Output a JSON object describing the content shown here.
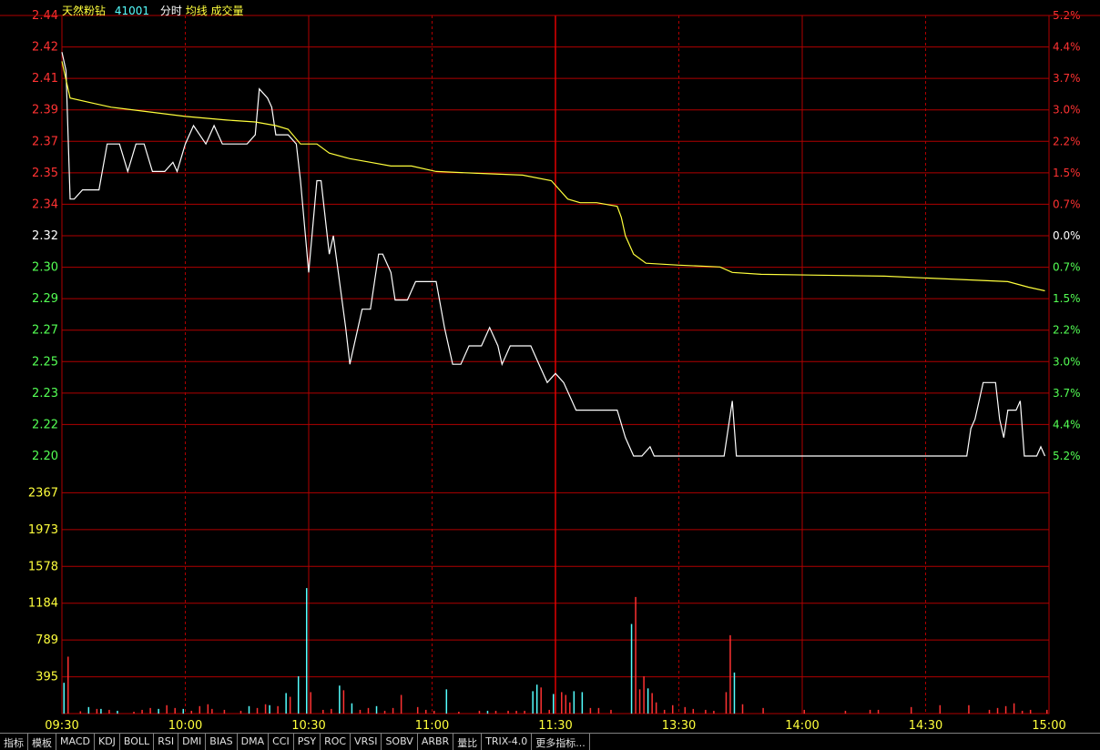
{
  "header": {
    "name": "天然粉钻",
    "code": "41001",
    "mode": "分时",
    "avg_label": "均线",
    "vol_label": "成交量"
  },
  "tabs": [
    "指标",
    "模板",
    "MACD",
    "KDJ",
    "BOLL",
    "RSI",
    "DMI",
    "BIAS",
    "DMA",
    "CCI",
    "PSY",
    "ROC",
    "VRSI",
    "SOBV",
    "ARBR",
    "量比",
    "TRIX-4.0",
    "更多指标..."
  ],
  "colors": {
    "grid": "#b00000",
    "up": "#ff3232",
    "down": "#54ff54",
    "flat": "#ffffff",
    "price_line": "#ffffff",
    "avg_line": "#ffff3c",
    "vol_up": "#ff3232",
    "vol_down": "#54ffff",
    "axis_text": "#ffff3c"
  },
  "chart_data": {
    "type": "line",
    "x_ticks": [
      "09:30",
      "10:00",
      "10:30",
      "11:00",
      "11:30",
      "13:30",
      "14:00",
      "14:30",
      "15:00"
    ],
    "price_ticks": [
      "2.44",
      "2.42",
      "2.41",
      "2.39",
      "2.37",
      "2.35",
      "2.34",
      "2.32",
      "2.30",
      "2.29",
      "2.27",
      "2.25",
      "2.23",
      "2.22",
      "2.20"
    ],
    "pct_ticks": [
      "5.2%",
      "4.4%",
      "3.7%",
      "3.0%",
      "2.2%",
      "1.5%",
      "0.7%",
      "0.0%",
      "0.7%",
      "1.5%",
      "2.2%",
      "3.0%",
      "3.7%",
      "4.4%",
      "5.2%"
    ],
    "volume_ticks": [
      "2367",
      "1973",
      "1578",
      "1184",
      "789",
      "395"
    ],
    "ylim": [
      2.2,
      2.44
    ],
    "prev_close": 2.32,
    "volume_ylim": [
      0,
      2760
    ],
    "minutes_total": 240,
    "series": [
      {
        "key": "price",
        "points": [
          [
            0,
            2.42
          ],
          [
            1,
            2.41
          ],
          [
            2,
            2.34
          ],
          [
            3,
            2.34
          ],
          [
            5,
            2.345
          ],
          [
            9,
            2.345
          ],
          [
            11,
            2.37
          ],
          [
            14,
            2.37
          ],
          [
            16,
            2.355
          ],
          [
            18,
            2.37
          ],
          [
            20,
            2.37
          ],
          [
            22,
            2.355
          ],
          [
            25,
            2.355
          ],
          [
            27,
            2.36
          ],
          [
            28,
            2.355
          ],
          [
            30,
            2.37
          ],
          [
            32,
            2.38
          ],
          [
            35,
            2.37
          ],
          [
            37,
            2.38
          ],
          [
            39,
            2.37
          ],
          [
            43,
            2.37
          ],
          [
            45,
            2.37
          ],
          [
            47,
            2.375
          ],
          [
            48,
            2.4
          ],
          [
            50,
            2.395
          ],
          [
            51,
            2.39
          ],
          [
            52,
            2.375
          ],
          [
            55,
            2.375
          ],
          [
            57,
            2.37
          ],
          [
            58,
            2.35
          ],
          [
            60,
            2.3
          ],
          [
            62,
            2.35
          ],
          [
            63,
            2.35
          ],
          [
            65,
            2.31
          ],
          [
            66,
            2.32
          ],
          [
            69,
            2.27
          ],
          [
            70,
            2.25
          ],
          [
            71,
            2.26
          ],
          [
            73,
            2.28
          ],
          [
            75,
            2.28
          ],
          [
            77,
            2.31
          ],
          [
            78,
            2.31
          ],
          [
            80,
            2.3
          ],
          [
            81,
            2.285
          ],
          [
            84,
            2.285
          ],
          [
            86,
            2.295
          ],
          [
            91,
            2.295
          ],
          [
            93,
            2.27
          ],
          [
            95,
            2.25
          ],
          [
            97,
            2.25
          ],
          [
            99,
            2.26
          ],
          [
            102,
            2.26
          ],
          [
            104,
            2.27
          ],
          [
            106,
            2.26
          ],
          [
            107,
            2.25
          ],
          [
            109,
            2.26
          ],
          [
            111,
            2.26
          ],
          [
            113,
            2.26
          ],
          [
            114,
            2.26
          ],
          [
            116,
            2.25
          ],
          [
            118,
            2.24
          ],
          [
            120,
            2.245
          ],
          [
            122,
            2.24
          ],
          [
            124,
            2.23
          ],
          [
            125,
            2.225
          ],
          [
            128,
            2.225
          ],
          [
            132,
            2.225
          ],
          [
            135,
            2.225
          ],
          [
            137,
            2.21
          ],
          [
            139,
            2.2
          ],
          [
            141,
            2.2
          ],
          [
            143,
            2.205
          ],
          [
            144,
            2.2
          ],
          [
            148,
            2.2
          ],
          [
            156,
            2.2
          ],
          [
            161,
            2.2
          ],
          [
            163,
            2.23
          ],
          [
            164,
            2.2
          ],
          [
            168,
            2.2
          ],
          [
            180,
            2.2
          ],
          [
            200,
            2.2
          ],
          [
            220,
            2.2
          ],
          [
            221,
            2.215
          ],
          [
            222,
            2.22
          ],
          [
            224,
            2.24
          ],
          [
            225,
            2.24
          ],
          [
            227,
            2.24
          ],
          [
            228,
            2.22
          ],
          [
            229,
            2.21
          ],
          [
            230,
            2.225
          ],
          [
            232,
            2.225
          ],
          [
            233,
            2.23
          ],
          [
            234,
            2.2
          ],
          [
            237,
            2.2
          ],
          [
            238,
            2.205
          ],
          [
            239,
            2.2
          ]
        ]
      },
      {
        "key": "avg",
        "points": [
          [
            0,
            2.415
          ],
          [
            1,
            2.405
          ],
          [
            2,
            2.395
          ],
          [
            8,
            2.392
          ],
          [
            12,
            2.39
          ],
          [
            30,
            2.385
          ],
          [
            40,
            2.383
          ],
          [
            47,
            2.382
          ],
          [
            52,
            2.38
          ],
          [
            55,
            2.378
          ],
          [
            58,
            2.37
          ],
          [
            62,
            2.37
          ],
          [
            65,
            2.365
          ],
          [
            70,
            2.362
          ],
          [
            75,
            2.36
          ],
          [
            80,
            2.358
          ],
          [
            85,
            2.358
          ],
          [
            91,
            2.355
          ],
          [
            101,
            2.354
          ],
          [
            112,
            2.353
          ],
          [
            119,
            2.35
          ],
          [
            121,
            2.345
          ],
          [
            123,
            2.34
          ],
          [
            126,
            2.338
          ],
          [
            130,
            2.338
          ],
          [
            135,
            2.336
          ],
          [
            136,
            2.33
          ],
          [
            137,
            2.32
          ],
          [
            139,
            2.31
          ],
          [
            142,
            2.305
          ],
          [
            150,
            2.304
          ],
          [
            160,
            2.303
          ],
          [
            163,
            2.3
          ],
          [
            170,
            2.299
          ],
          [
            200,
            2.298
          ],
          [
            230,
            2.295
          ],
          [
            235,
            2.292
          ],
          [
            239,
            2.29
          ]
        ]
      }
    ],
    "volume": [
      [
        0,
        330,
        "down"
      ],
      [
        1,
        610,
        "up"
      ],
      [
        4,
        25,
        "up"
      ],
      [
        6,
        70,
        "down"
      ],
      [
        8,
        50,
        "up"
      ],
      [
        9,
        50,
        "down"
      ],
      [
        11,
        40,
        "up"
      ],
      [
        13,
        30,
        "down"
      ],
      [
        17,
        20,
        "up"
      ],
      [
        19,
        40,
        "up"
      ],
      [
        21,
        60,
        "up"
      ],
      [
        23,
        50,
        "down"
      ],
      [
        25,
        90,
        "up"
      ],
      [
        27,
        60,
        "up"
      ],
      [
        29,
        50,
        "down"
      ],
      [
        31,
        30,
        "up"
      ],
      [
        33,
        80,
        "up"
      ],
      [
        35,
        100,
        "up"
      ],
      [
        36,
        50,
        "up"
      ],
      [
        39,
        40,
        "up"
      ],
      [
        43,
        30,
        "up"
      ],
      [
        45,
        80,
        "down"
      ],
      [
        47,
        60,
        "up"
      ],
      [
        49,
        100,
        "up"
      ],
      [
        50,
        90,
        "down"
      ],
      [
        52,
        80,
        "up"
      ],
      [
        54,
        220,
        "down"
      ],
      [
        55,
        180,
        "up"
      ],
      [
        57,
        400,
        "down"
      ],
      [
        59,
        1345,
        "down"
      ],
      [
        60,
        230,
        "up"
      ],
      [
        63,
        40,
        "up"
      ],
      [
        65,
        50,
        "up"
      ],
      [
        67,
        300,
        "down"
      ],
      [
        68,
        250,
        "up"
      ],
      [
        70,
        110,
        "down"
      ],
      [
        72,
        40,
        "up"
      ],
      [
        74,
        60,
        "up"
      ],
      [
        76,
        80,
        "down"
      ],
      [
        78,
        30,
        "up"
      ],
      [
        80,
        60,
        "up"
      ],
      [
        82,
        200,
        "up"
      ],
      [
        86,
        70,
        "up"
      ],
      [
        88,
        40,
        "up"
      ],
      [
        90,
        30,
        "up"
      ],
      [
        93,
        260,
        "down"
      ],
      [
        96,
        20,
        "up"
      ],
      [
        101,
        30,
        "up"
      ],
      [
        103,
        30,
        "down"
      ],
      [
        105,
        30,
        "up"
      ],
      [
        108,
        30,
        "up"
      ],
      [
        110,
        30,
        "up"
      ],
      [
        112,
        30,
        "up"
      ],
      [
        114,
        240,
        "down"
      ],
      [
        115,
        310,
        "down"
      ],
      [
        116,
        280,
        "up"
      ],
      [
        118,
        40,
        "up"
      ],
      [
        119,
        210,
        "down"
      ],
      [
        121,
        230,
        "up"
      ],
      [
        122,
        200,
        "up"
      ],
      [
        123,
        120,
        "up"
      ],
      [
        124,
        240,
        "down"
      ],
      [
        126,
        230,
        "down"
      ],
      [
        128,
        60,
        "up"
      ],
      [
        130,
        60,
        "up"
      ],
      [
        133,
        40,
        "up"
      ],
      [
        138,
        960,
        "down"
      ],
      [
        139,
        1250,
        "up"
      ],
      [
        140,
        260,
        "up"
      ],
      [
        141,
        400,
        "up"
      ],
      [
        142,
        270,
        "down"
      ],
      [
        143,
        220,
        "up"
      ],
      [
        144,
        120,
        "up"
      ],
      [
        146,
        40,
        "up"
      ],
      [
        148,
        90,
        "up"
      ],
      [
        151,
        70,
        "up"
      ],
      [
        153,
        50,
        "up"
      ],
      [
        156,
        40,
        "up"
      ],
      [
        158,
        30,
        "up"
      ],
      [
        161,
        230,
        "up"
      ],
      [
        162,
        840,
        "up"
      ],
      [
        163,
        440,
        "down"
      ],
      [
        165,
        100,
        "up"
      ],
      [
        170,
        60,
        "up"
      ],
      [
        180,
        40,
        "up"
      ],
      [
        190,
        30,
        "up"
      ],
      [
        196,
        40,
        "up"
      ],
      [
        198,
        40,
        "up"
      ],
      [
        206,
        70,
        "up"
      ],
      [
        213,
        90,
        "up"
      ],
      [
        220,
        90,
        "up"
      ],
      [
        225,
        40,
        "up"
      ],
      [
        227,
        60,
        "up"
      ],
      [
        229,
        80,
        "up"
      ],
      [
        231,
        110,
        "up"
      ],
      [
        233,
        30,
        "up"
      ],
      [
        235,
        40,
        "up"
      ],
      [
        239,
        40,
        "up"
      ],
      [
        260,
        0,
        "up"
      ]
    ]
  }
}
